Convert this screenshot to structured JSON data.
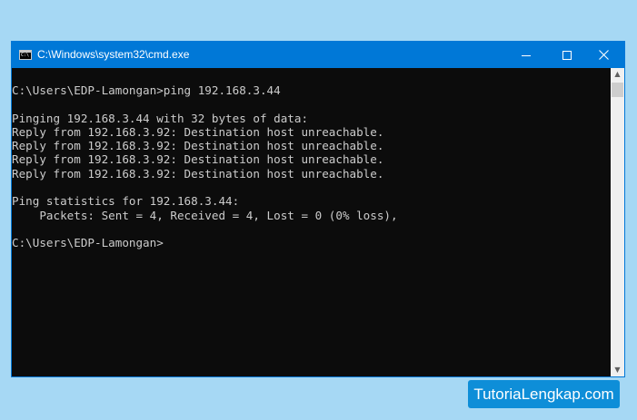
{
  "window": {
    "title": "C:\\Windows\\system32\\cmd.exe",
    "icon": "cmd-console-icon",
    "icon_text": "C:\\"
  },
  "controls": {
    "minimize_icon": "minimize-icon",
    "maximize_icon": "maximize-icon",
    "close_icon": "close-icon"
  },
  "console": {
    "lines": [
      "C:\\Users\\EDP-Lamongan>ping 192.168.3.44",
      "",
      "Pinging 192.168.3.44 with 32 bytes of data:",
      "Reply from 192.168.3.92: Destination host unreachable.",
      "Reply from 192.168.3.92: Destination host unreachable.",
      "Reply from 192.168.3.92: Destination host unreachable.",
      "Reply from 192.168.3.92: Destination host unreachable.",
      "",
      "Ping statistics for 192.168.3.44:",
      "    Packets: Sent = 4, Received = 4, Lost = 0 (0% loss),",
      "",
      "C:\\Users\\EDP-Lamongan>"
    ]
  },
  "scrollbar": {
    "up_icon": "scroll-up-arrow-icon",
    "down_icon": "scroll-down-arrow-icon"
  },
  "watermark": {
    "text": "TutoriaLengkap.com"
  },
  "colors": {
    "page_background": "#a6d8f4",
    "titlebar": "#0078d7",
    "console_background": "#0c0c0c",
    "console_text": "#cccccc",
    "watermark_background": "#0e8ed8"
  }
}
